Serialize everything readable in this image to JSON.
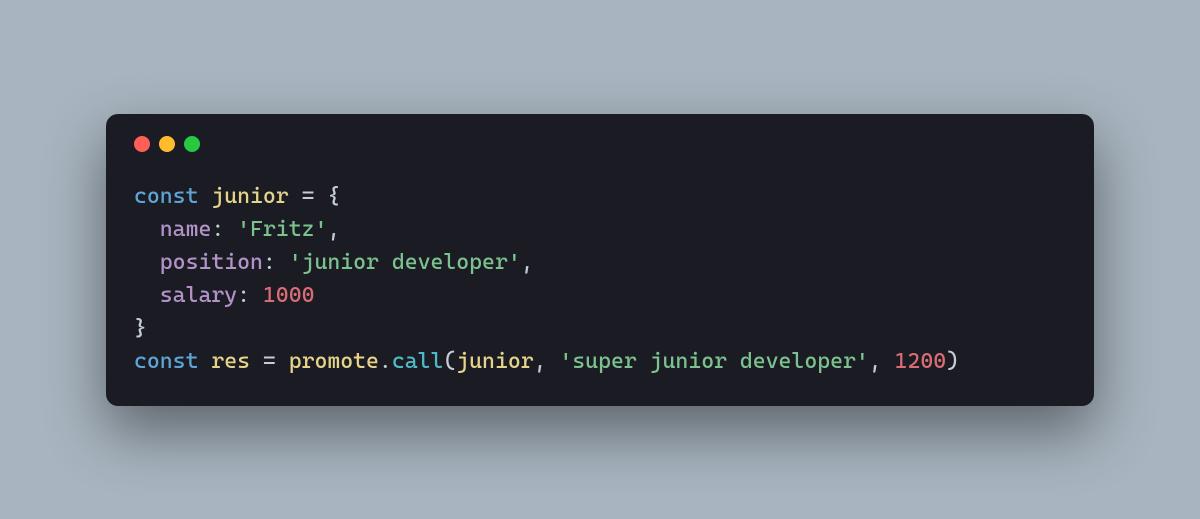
{
  "code": {
    "line1": {
      "kw": "const",
      "sp1": " ",
      "ident": "junior",
      "sp2": " ",
      "eq": "=",
      "sp3": " ",
      "brace": "{"
    },
    "line2": {
      "indent": "  ",
      "prop": "name",
      "colon": ":",
      "sp": " ",
      "str": "'Fritz'",
      "comma": ","
    },
    "line3": {
      "indent": "  ",
      "prop": "position",
      "colon": ":",
      "sp": " ",
      "str": "'junior developer'",
      "comma": ","
    },
    "line4": {
      "indent": "  ",
      "prop": "salary",
      "colon": ":",
      "sp": " ",
      "num": "1000"
    },
    "line5": {
      "brace": "}"
    },
    "line6": {
      "kw": "const",
      "sp1": " ",
      "ident": "res",
      "sp2": " ",
      "eq": "=",
      "sp3": " ",
      "fn1": "promote",
      "dot": ".",
      "fn2": "call",
      "lp": "(",
      "arg1": "junior",
      "comma1": ",",
      "sp4": " ",
      "str": "'super junior developer'",
      "comma2": ",",
      "sp5": " ",
      "num": "1200",
      "rp": ")"
    }
  }
}
